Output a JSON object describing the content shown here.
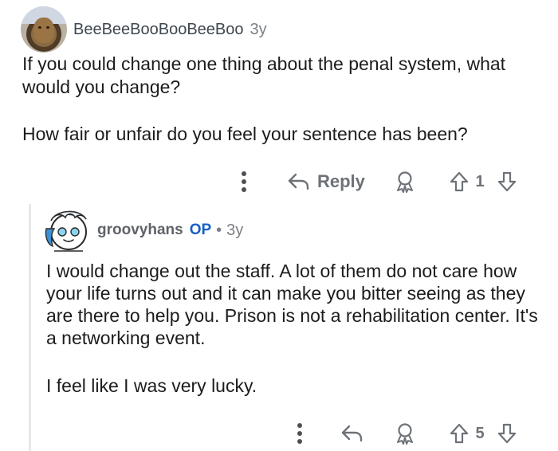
{
  "parent_comment": {
    "username": "BeeBeeBooBooBeeBoo",
    "age": "3y",
    "paragraphs": [
      "If you could change one thing about the penal system, what would you change?",
      "How fair or unfair do you feel your sentence has been?"
    ],
    "reply_label": "Reply",
    "vote_count": "1"
  },
  "reply_comment": {
    "username": "groovyhans",
    "op_badge": "OP",
    "separator": "•",
    "age": "3y",
    "paragraphs": [
      "I would change out the staff. A lot of them do not care how your life turns out and it can make you bitter seeing as they are there to help you. Prison is not a rehabilitation center. It's a networking event.",
      "I feel like I was very lucky."
    ],
    "vote_count": "5"
  },
  "icons": {
    "more": "more-vertical-icon",
    "reply": "reply-arrow-icon",
    "award": "award-icon",
    "upvote": "upvote-arrow-icon",
    "downvote": "downvote-arrow-icon"
  },
  "colors": {
    "text": "#1c1c1c",
    "meta": "#7b7f83",
    "action": "#6d7278",
    "op": "#1760c4",
    "thread_line": "#e7e8ea"
  }
}
